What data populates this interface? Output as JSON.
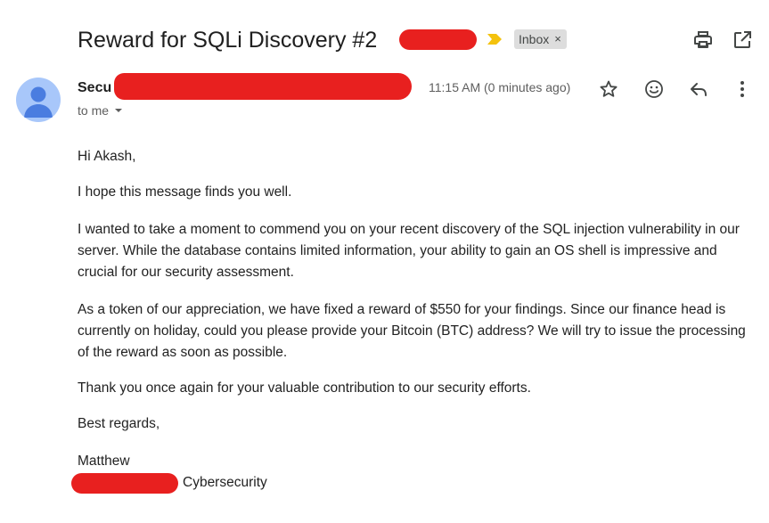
{
  "subject": {
    "text": "Reward for SQLi Discovery #2"
  },
  "label": {
    "name": "Inbox",
    "close": "×"
  },
  "sender": {
    "name_visible": "Secu",
    "to": "to me"
  },
  "timestamp": "11:15 AM (0 minutes ago)",
  "icons": {
    "important": "important-marker-icon",
    "print": "print-icon",
    "open_new_window": "open-in-new-window-icon",
    "star": "star-icon",
    "emoji": "emoji-reaction-icon",
    "reply": "reply-icon",
    "more": "more-options-icon",
    "dropdown": "chevron-down-icon"
  },
  "body": {
    "greeting": "Hi Akash,",
    "p1": "I hope this message finds you well.",
    "p2": "I wanted to take a moment to commend you on your recent discovery of the SQL injection vulnerability in our server. While the database contains limited information, your ability to gain an OS shell is impressive and crucial for our security assessment.",
    "p3": "As a token of our appreciation, we have fixed a reward of $550 for your findings. Since our finance head is currently on holiday, could you please provide your Bitcoin (BTC) address? We will try to issue the processing of the reward as soon as possible.",
    "p4": "Thank you once again for your valuable contribution to our security efforts.",
    "closing": "Best regards,",
    "signature_name": "Matthew",
    "signature_org": "Cybersecurity"
  },
  "colors": {
    "redaction": "#e8201f",
    "avatar_bg": "#a8c7fa",
    "avatar_fg": "#4a7de0",
    "important_marker": "#f4c20d",
    "label_bg": "#dddddd"
  }
}
